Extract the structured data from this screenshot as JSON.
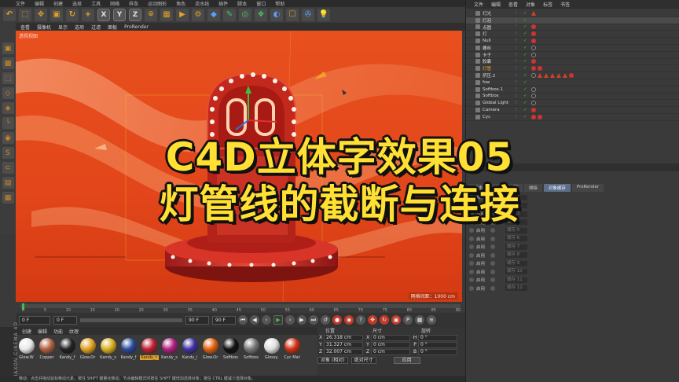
{
  "menubar": [
    "文件",
    "编辑",
    "创建",
    "选择",
    "工具",
    "网格",
    "样条",
    "运动图形",
    "角色",
    "流水线",
    "插件",
    "脚本",
    "窗口",
    "帮助"
  ],
  "toolbar": {
    "x": "X",
    "y": "Y",
    "z": "Z"
  },
  "viewport": {
    "menu": [
      "查看",
      "摄像机",
      "显示",
      "选项",
      "过滤",
      "面板",
      "ProRender"
    ],
    "label": "透视视图",
    "grid": "网格间距：1000 cm"
  },
  "timeline": {
    "ticks": [
      "0",
      "5",
      "10",
      "15",
      "20",
      "25",
      "30",
      "35",
      "40",
      "45",
      "50",
      "55",
      "60",
      "65",
      "70",
      "75",
      "80",
      "85",
      "90"
    ],
    "current_frame": "0 F",
    "start_frame": "0 F",
    "end_frame": "90 F",
    "end_frame2": "90 F"
  },
  "materials": {
    "menu": [
      "创建",
      "编辑",
      "功能",
      "纹理"
    ],
    "items": [
      {
        "name": "Glow.W",
        "color": "#e8e8e8"
      },
      {
        "name": "Copper",
        "color": "#b06040"
      },
      {
        "name": "Kandy_f",
        "color": "#222222"
      },
      {
        "name": "Glow.Or",
        "color": "#e0a020"
      },
      {
        "name": "Kandy_s",
        "color": "#d8b020"
      },
      {
        "name": "Kandy_f",
        "color": "#2a4a9a"
      },
      {
        "name": "Kandy_r",
        "color": "#c02030",
        "selected": true
      },
      {
        "name": "Kandy_s",
        "color": "#b02080"
      },
      {
        "name": "Kandy_i",
        "color": "#4030a0"
      },
      {
        "name": "Glow.Or",
        "color": "#e06010"
      },
      {
        "name": "Softbox",
        "color": "#111111"
      },
      {
        "name": "Softbox",
        "color": "#777777"
      },
      {
        "name": "Glossy.",
        "color": "#dddddd"
      },
      {
        "name": "Cyc Mat",
        "color": "#d03010"
      }
    ]
  },
  "coords": {
    "headers": [
      "位置",
      "尺寸",
      "旋转"
    ],
    "rows": [
      {
        "axis": "X",
        "pos": "26.318 cm",
        "size_axis": "X",
        "size": "0 cm",
        "rot_axis": "H",
        "rot": "0 °"
      },
      {
        "axis": "Y",
        "pos": "31.327 cm",
        "size_axis": "Y",
        "size": "0 cm",
        "rot_axis": "P",
        "rot": "0 °"
      },
      {
        "axis": "Z",
        "pos": "32.007 cm",
        "size_axis": "Z",
        "size": "0 cm",
        "rot_axis": "B",
        "rot": "0 °"
      }
    ],
    "mode": "对象 (相对)",
    "size_mode": "绝对尺寸",
    "apply": "应用"
  },
  "status": "移动：点击并拖动鼠标移动元素。按住 SHIFT 键量化移动；节点编辑模式时按住 SHIFT 键增加选择对象；按住 CTRL 键减少选择对象。",
  "maxon": "MAXON CINEMA 4D",
  "object_manager": {
    "menu": [
      "文件",
      "编辑",
      "查看",
      "对象",
      "标签",
      "书签"
    ],
    "objects": [
      {
        "name": "灯光",
        "tags": [
          "tri"
        ]
      },
      {
        "name": "灯泡",
        "tags": []
      },
      {
        "name": "点圆",
        "tags": [
          "dot"
        ]
      },
      {
        "name": "灯",
        "tags": [
          "dot"
        ]
      },
      {
        "name": "Null",
        "tags": [
          "dot"
        ]
      },
      {
        "name": "螺丝",
        "tags": [
          "dk"
        ]
      },
      {
        "name": "卡子",
        "tags": [
          "dk"
        ]
      },
      {
        "name": "胶囊",
        "tags": [
          "dot"
        ]
      },
      {
        "name": "灯管",
        "tags": [
          "dot",
          "dot"
        ],
        "orange": true
      },
      {
        "name": "挤压.2",
        "tags": [
          "dk",
          "tri",
          "tri",
          "tri",
          "tri",
          "tri",
          "dot"
        ]
      },
      {
        "name": "fsw",
        "tags": []
      },
      {
        "name": "Softbox.1",
        "tags": [
          "dk"
        ]
      },
      {
        "name": "Softbox",
        "tags": [
          "dk"
        ]
      },
      {
        "name": "Global Light",
        "tags": [
          "dk"
        ]
      },
      {
        "name": "Camera",
        "tags": [
          "dot"
        ]
      },
      {
        "name": "Cyc",
        "tags": [
          "dot",
          "dot"
        ]
      }
    ]
  },
  "attribute_manager": {
    "tabs": [
      "基本",
      "标签",
      "Gl",
      "排除",
      "对象缓存",
      "ProRender"
    ],
    "active_tab": "对象缓存",
    "rows": [
      {
        "label": "启用",
        "val": "缓存 1"
      },
      {
        "label": "启用",
        "val": "缓存 2"
      },
      {
        "label": "启用",
        "val": "缓存 3"
      },
      {
        "label": "启用",
        "val": "缓存 4"
      },
      {
        "label": "启用",
        "val": "缓存 5"
      },
      {
        "label": "启用",
        "val": "缓存 6"
      },
      {
        "label": "启用",
        "val": "缓存 7"
      },
      {
        "label": "启用",
        "val": "缓存 8"
      },
      {
        "label": "启用",
        "val": "缓存 9"
      },
      {
        "label": "启用",
        "val": "缓存 10"
      },
      {
        "label": "启用",
        "val": "缓存 11"
      },
      {
        "label": "启用",
        "val": "缓存 12"
      }
    ]
  },
  "overlay": {
    "line1": "C4D立体字效果05",
    "line2": "灯管线的截断与连接",
    "color": "#ffe033"
  }
}
